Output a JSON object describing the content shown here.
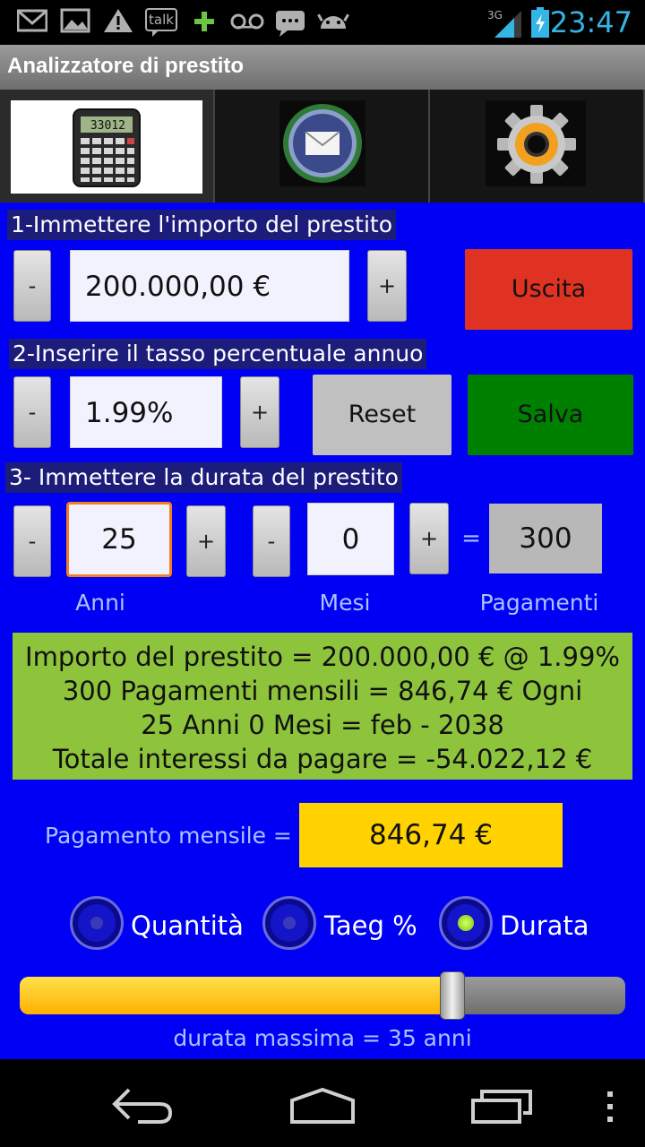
{
  "status_bar": {
    "icons": [
      "gmail-icon",
      "gallery-icon",
      "warning-icon",
      "talk-icon",
      "plus-icon",
      "voicemail-icon",
      "messaging-icon",
      "android-icon",
      "signal-3g-icon",
      "battery-charging-icon"
    ],
    "talk_text": "talk",
    "network": "3G",
    "time": "23:47"
  },
  "app": {
    "title": "Analizzatore di prestito"
  },
  "tabs": [
    {
      "name": "calculator-tab",
      "icon": "calculator-icon",
      "display": "33012",
      "active": true
    },
    {
      "name": "mail-tab",
      "icon": "mail-icon",
      "active": false
    },
    {
      "name": "settings-tab",
      "icon": "gear-icon",
      "active": false
    }
  ],
  "section1": {
    "label": "1-Immettere l'importo del prestito",
    "minus": "-",
    "value": "200.000,00 €",
    "plus": "+",
    "exit_button": "Uscita"
  },
  "section2": {
    "label": "2-Inserire il tasso percentuale annuo",
    "minus": "-",
    "value": "1.99%",
    "plus": "+",
    "reset_button": "Reset",
    "save_button": "Salva"
  },
  "section3": {
    "label": "3- Immettere la durata del prestito",
    "years_minus": "-",
    "years_value": "25",
    "years_plus": "+",
    "months_minus": "-",
    "months_value": "0",
    "months_plus": "+",
    "equals": "=",
    "payments_value": "300",
    "years_caption": "Anni",
    "months_caption": "Mesi",
    "payments_caption": "Pagamenti"
  },
  "summary": {
    "line1": "Importo del prestito = 200.000,00 € @ 1.99%",
    "line2": "300 Pagamenti mensili = 846,74 € Ogni",
    "line3": "25 Anni 0 Mesi = feb - 2038",
    "line4": "Totale interessi da pagare = -54.022,12 €"
  },
  "monthly_payment": {
    "label": "Pagamento mensile =",
    "value": "846,74 €"
  },
  "radio_options": [
    {
      "label": "Quantità",
      "checked": false
    },
    {
      "label": "Taeg %",
      "checked": false
    },
    {
      "label": "Durata",
      "checked": true
    }
  ],
  "slider": {
    "value": 25,
    "max": 35,
    "caption": "durata massima = 35 anni"
  },
  "colors": {
    "main_background": "#0000f5",
    "exit_red": "#e03222",
    "save_green": "#008000",
    "reset_gray": "#c0c0c0",
    "summary_green": "#8dc43c",
    "payment_yellow": "#ffd200",
    "clock_blue": "#33b5e5"
  },
  "nav_bar": [
    "back-icon",
    "home-icon",
    "recent-apps-icon",
    "menu-icon"
  ]
}
